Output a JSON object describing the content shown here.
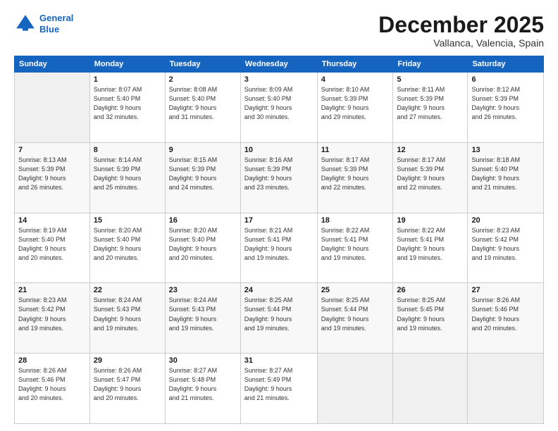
{
  "header": {
    "logo_line1": "General",
    "logo_line2": "Blue",
    "month": "December 2025",
    "location": "Vallanca, Valencia, Spain"
  },
  "weekdays": [
    "Sunday",
    "Monday",
    "Tuesday",
    "Wednesday",
    "Thursday",
    "Friday",
    "Saturday"
  ],
  "weeks": [
    [
      {
        "day": "",
        "info": ""
      },
      {
        "day": "1",
        "info": "Sunrise: 8:07 AM\nSunset: 5:40 PM\nDaylight: 9 hours\nand 32 minutes."
      },
      {
        "day": "2",
        "info": "Sunrise: 8:08 AM\nSunset: 5:40 PM\nDaylight: 9 hours\nand 31 minutes."
      },
      {
        "day": "3",
        "info": "Sunrise: 8:09 AM\nSunset: 5:40 PM\nDaylight: 9 hours\nand 30 minutes."
      },
      {
        "day": "4",
        "info": "Sunrise: 8:10 AM\nSunset: 5:39 PM\nDaylight: 9 hours\nand 29 minutes."
      },
      {
        "day": "5",
        "info": "Sunrise: 8:11 AM\nSunset: 5:39 PM\nDaylight: 9 hours\nand 27 minutes."
      },
      {
        "day": "6",
        "info": "Sunrise: 8:12 AM\nSunset: 5:39 PM\nDaylight: 9 hours\nand 26 minutes."
      }
    ],
    [
      {
        "day": "7",
        "info": "Sunrise: 8:13 AM\nSunset: 5:39 PM\nDaylight: 9 hours\nand 26 minutes."
      },
      {
        "day": "8",
        "info": "Sunrise: 8:14 AM\nSunset: 5:39 PM\nDaylight: 9 hours\nand 25 minutes."
      },
      {
        "day": "9",
        "info": "Sunrise: 8:15 AM\nSunset: 5:39 PM\nDaylight: 9 hours\nand 24 minutes."
      },
      {
        "day": "10",
        "info": "Sunrise: 8:16 AM\nSunset: 5:39 PM\nDaylight: 9 hours\nand 23 minutes."
      },
      {
        "day": "11",
        "info": "Sunrise: 8:17 AM\nSunset: 5:39 PM\nDaylight: 9 hours\nand 22 minutes."
      },
      {
        "day": "12",
        "info": "Sunrise: 8:17 AM\nSunset: 5:39 PM\nDaylight: 9 hours\nand 22 minutes."
      },
      {
        "day": "13",
        "info": "Sunrise: 8:18 AM\nSunset: 5:40 PM\nDaylight: 9 hours\nand 21 minutes."
      }
    ],
    [
      {
        "day": "14",
        "info": "Sunrise: 8:19 AM\nSunset: 5:40 PM\nDaylight: 9 hours\nand 20 minutes."
      },
      {
        "day": "15",
        "info": "Sunrise: 8:20 AM\nSunset: 5:40 PM\nDaylight: 9 hours\nand 20 minutes."
      },
      {
        "day": "16",
        "info": "Sunrise: 8:20 AM\nSunset: 5:40 PM\nDaylight: 9 hours\nand 20 minutes."
      },
      {
        "day": "17",
        "info": "Sunrise: 8:21 AM\nSunset: 5:41 PM\nDaylight: 9 hours\nand 19 minutes."
      },
      {
        "day": "18",
        "info": "Sunrise: 8:22 AM\nSunset: 5:41 PM\nDaylight: 9 hours\nand 19 minutes."
      },
      {
        "day": "19",
        "info": "Sunrise: 8:22 AM\nSunset: 5:41 PM\nDaylight: 9 hours\nand 19 minutes."
      },
      {
        "day": "20",
        "info": "Sunrise: 8:23 AM\nSunset: 5:42 PM\nDaylight: 9 hours\nand 19 minutes."
      }
    ],
    [
      {
        "day": "21",
        "info": "Sunrise: 8:23 AM\nSunset: 5:42 PM\nDaylight: 9 hours\nand 19 minutes."
      },
      {
        "day": "22",
        "info": "Sunrise: 8:24 AM\nSunset: 5:43 PM\nDaylight: 9 hours\nand 19 minutes."
      },
      {
        "day": "23",
        "info": "Sunrise: 8:24 AM\nSunset: 5:43 PM\nDaylight: 9 hours\nand 19 minutes."
      },
      {
        "day": "24",
        "info": "Sunrise: 8:25 AM\nSunset: 5:44 PM\nDaylight: 9 hours\nand 19 minutes."
      },
      {
        "day": "25",
        "info": "Sunrise: 8:25 AM\nSunset: 5:44 PM\nDaylight: 9 hours\nand 19 minutes."
      },
      {
        "day": "26",
        "info": "Sunrise: 8:25 AM\nSunset: 5:45 PM\nDaylight: 9 hours\nand 19 minutes."
      },
      {
        "day": "27",
        "info": "Sunrise: 8:26 AM\nSunset: 5:46 PM\nDaylight: 9 hours\nand 20 minutes."
      }
    ],
    [
      {
        "day": "28",
        "info": "Sunrise: 8:26 AM\nSunset: 5:46 PM\nDaylight: 9 hours\nand 20 minutes."
      },
      {
        "day": "29",
        "info": "Sunrise: 8:26 AM\nSunset: 5:47 PM\nDaylight: 9 hours\nand 20 minutes."
      },
      {
        "day": "30",
        "info": "Sunrise: 8:27 AM\nSunset: 5:48 PM\nDaylight: 9 hours\nand 21 minutes."
      },
      {
        "day": "31",
        "info": "Sunrise: 8:27 AM\nSunset: 5:49 PM\nDaylight: 9 hours\nand 21 minutes."
      },
      {
        "day": "",
        "info": ""
      },
      {
        "day": "",
        "info": ""
      },
      {
        "day": "",
        "info": ""
      }
    ]
  ]
}
